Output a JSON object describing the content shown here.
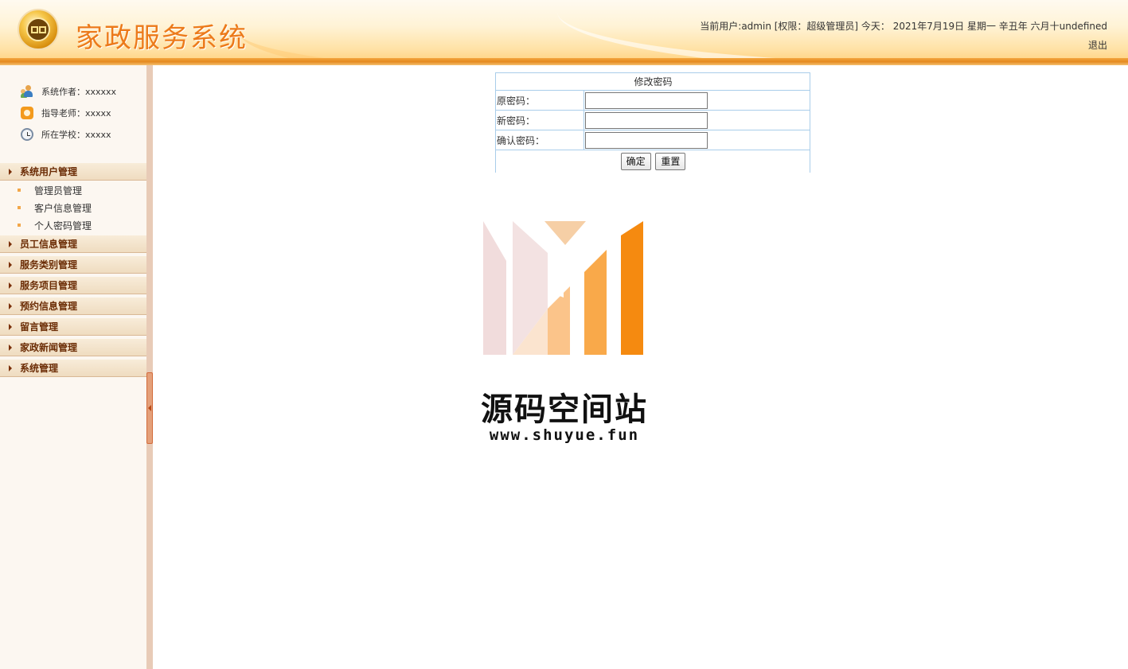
{
  "app": {
    "title": "家政服务系统"
  },
  "header": {
    "user_info": "当前用户:admin [权限：超级管理员] 今天： 2021年7月19日 星期一 辛丑年 六月十undefined",
    "logout_label": "退出"
  },
  "sidebar": {
    "info": [
      {
        "label": "系统作者：xxxxxx",
        "icon": "users-icon"
      },
      {
        "label": "指导老师：xxxxx",
        "icon": "phone-icon"
      },
      {
        "label": "所在学校：xxxxx",
        "icon": "clock-icon"
      }
    ],
    "groups": [
      {
        "label": "系统用户管理",
        "expanded": true
      },
      {
        "label": "员工信息管理"
      },
      {
        "label": "服务类别管理"
      },
      {
        "label": "服务项目管理"
      },
      {
        "label": "预约信息管理"
      },
      {
        "label": "留言管理"
      },
      {
        "label": "家政新闻管理"
      },
      {
        "label": "系统管理"
      }
    ],
    "sub_items": [
      {
        "label": "管理员管理"
      },
      {
        "label": "客户信息管理"
      },
      {
        "label": "个人密码管理"
      }
    ]
  },
  "form": {
    "title": "修改密码",
    "fields": [
      {
        "label": "原密码：",
        "value": ""
      },
      {
        "label": "新密码：",
        "value": ""
      },
      {
        "label": "确认密码：",
        "value": ""
      }
    ],
    "submit_label": "确定",
    "reset_label": "重置"
  },
  "watermark": {
    "name": "源码空间站",
    "url": "www.shuyue.fun"
  },
  "colors": {
    "accent": "#ec7a1a",
    "menu_text": "#6b2c05",
    "header_stripe": "#e5891f",
    "table_border": "#a9cdea"
  }
}
